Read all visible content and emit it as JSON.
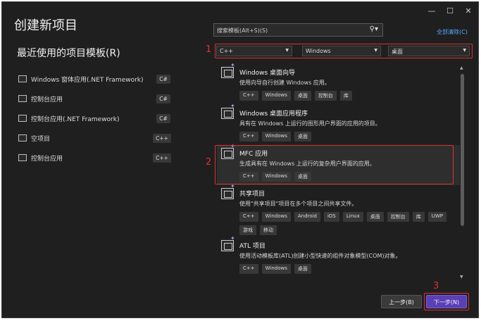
{
  "window_controls": {
    "minimize": "—",
    "maximize": "☐",
    "close": "✕"
  },
  "title": "创建新项目",
  "recent": {
    "heading": "最近使用的项目模板(R)",
    "items": [
      {
        "label": "Windows 窗体应用(.NET Framework)",
        "lang": "C#",
        "icon": "winforms-icon"
      },
      {
        "label": "控制台应用",
        "lang": "C#",
        "icon": "console-icon"
      },
      {
        "label": "控制台应用(.NET Framework)",
        "lang": "C#",
        "icon": "console-icon"
      },
      {
        "label": "空项目",
        "lang": "C++",
        "icon": "empty-project-icon"
      },
      {
        "label": "控制台应用",
        "lang": "C++",
        "icon": "console-icon"
      }
    ]
  },
  "search": {
    "placeholder": "搜索模板(Alt+S)(S)",
    "clear_all": "全部清除(C)"
  },
  "filters": {
    "language": "C++",
    "platform": "Windows",
    "project_type": "桌面"
  },
  "markers": {
    "m1": "1",
    "m2": "2",
    "m3": "3"
  },
  "templates": [
    {
      "name": "Windows 桌面向导",
      "desc": "使用向导自行创建 Windows 应用。",
      "tags": [
        "C++",
        "Windows",
        "桌面",
        "控制台",
        "库"
      ]
    },
    {
      "name": "Windows 桌面应用程序",
      "desc": "具有在 Windows 上运行的图形用户界面的应用的项目。",
      "tags": [
        "C++",
        "Windows",
        "桌面"
      ]
    },
    {
      "name": "MFC 应用",
      "desc": "生成具有在 Windows 上运行的复杂用户界面的应用。",
      "tags": [
        "C++",
        "Windows",
        "桌面"
      ]
    },
    {
      "name": "共享项目",
      "desc": "使用\"共享项目\"项目在多个项目之间共享文件。",
      "tags": [
        "C++",
        "Windows",
        "Android",
        "iOS",
        "Linux",
        "桌面",
        "控制台",
        "库",
        "UWP",
        "游戏",
        "移动"
      ]
    },
    {
      "name": "ATL 项目",
      "desc": "使用活动模板库(ATL)创建小型快速的组件对象模型(COM)对象。",
      "tags": [
        "C++",
        "Windows",
        "桌面"
      ]
    }
  ],
  "buttons": {
    "back": "上一步(B)",
    "next": "下一步(N)"
  },
  "colors": {
    "accent": "#5a3fb5",
    "highlight_red": "#e03030",
    "link": "#5aa8ff"
  }
}
